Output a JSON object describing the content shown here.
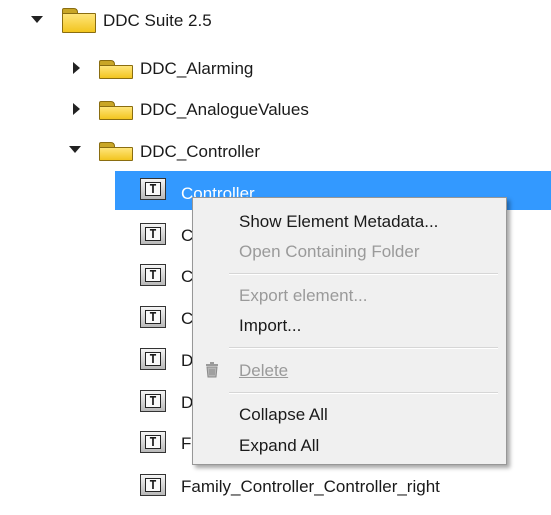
{
  "tree": {
    "root": {
      "label": "DDC Suite 2.5"
    },
    "folders": [
      {
        "label": "DDC_Alarming"
      },
      {
        "label": "DDC_AnalogueValues"
      },
      {
        "label": "DDC_Controller"
      }
    ],
    "items": [
      {
        "label": "Controller",
        "icon": "T"
      },
      {
        "label": "C",
        "icon": "T"
      },
      {
        "label": "C",
        "icon": "T"
      },
      {
        "label": "C",
        "icon": "T"
      },
      {
        "label": "D",
        "icon": "T"
      },
      {
        "label": "D",
        "icon": "T"
      },
      {
        "label": "F",
        "icon": "T"
      },
      {
        "label": "Family_Controller_Controller_right",
        "icon": "T"
      }
    ]
  },
  "context_menu": {
    "items": [
      {
        "label": "Show Element Metadata...",
        "enabled": true
      },
      {
        "label": "Open Containing Folder",
        "enabled": false
      },
      {
        "label": "Export element...",
        "enabled": false
      },
      {
        "label": "Import...",
        "enabled": true
      },
      {
        "label": "Delete",
        "enabled": false,
        "icon": "trash-icon"
      },
      {
        "label": "Collapse All",
        "enabled": true
      },
      {
        "label": "Expand All",
        "enabled": true
      }
    ]
  },
  "colors": {
    "selection": "#3399ff",
    "menu_background": "#f0f0f0",
    "folder": "#f2c51f"
  }
}
